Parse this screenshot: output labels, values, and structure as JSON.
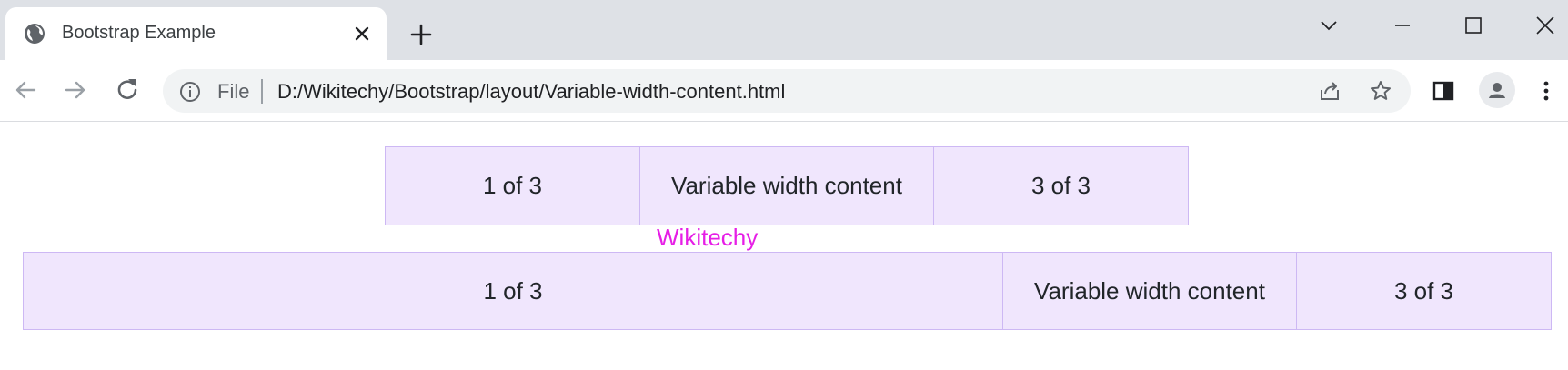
{
  "browser": {
    "tab_title": "Bootstrap Example",
    "address_scheme": "File",
    "address_url": "D:/Wikitechy/Bootstrap/layout/Variable-width-content.html"
  },
  "page": {
    "row1": [
      "1 of 3",
      "Variable width content",
      "3 of 3"
    ],
    "brand": "Wikitechy",
    "row2": [
      "1 of 3",
      "Variable width content",
      "3 of 3"
    ],
    "colors": {
      "cell_bg": "#f0e6fd",
      "cell_border": "#cdb8f4",
      "brand": "#e61ee6"
    }
  },
  "icons": [
    "globe-icon",
    "close-icon",
    "plus-icon",
    "chevron-down-icon",
    "minimize-icon",
    "maximize-icon",
    "window-close-icon",
    "back-arrow-icon",
    "forward-arrow-icon",
    "reload-icon",
    "info-icon",
    "share-icon",
    "star-icon",
    "side-panel-icon",
    "profile-icon",
    "more-vert-icon"
  ]
}
